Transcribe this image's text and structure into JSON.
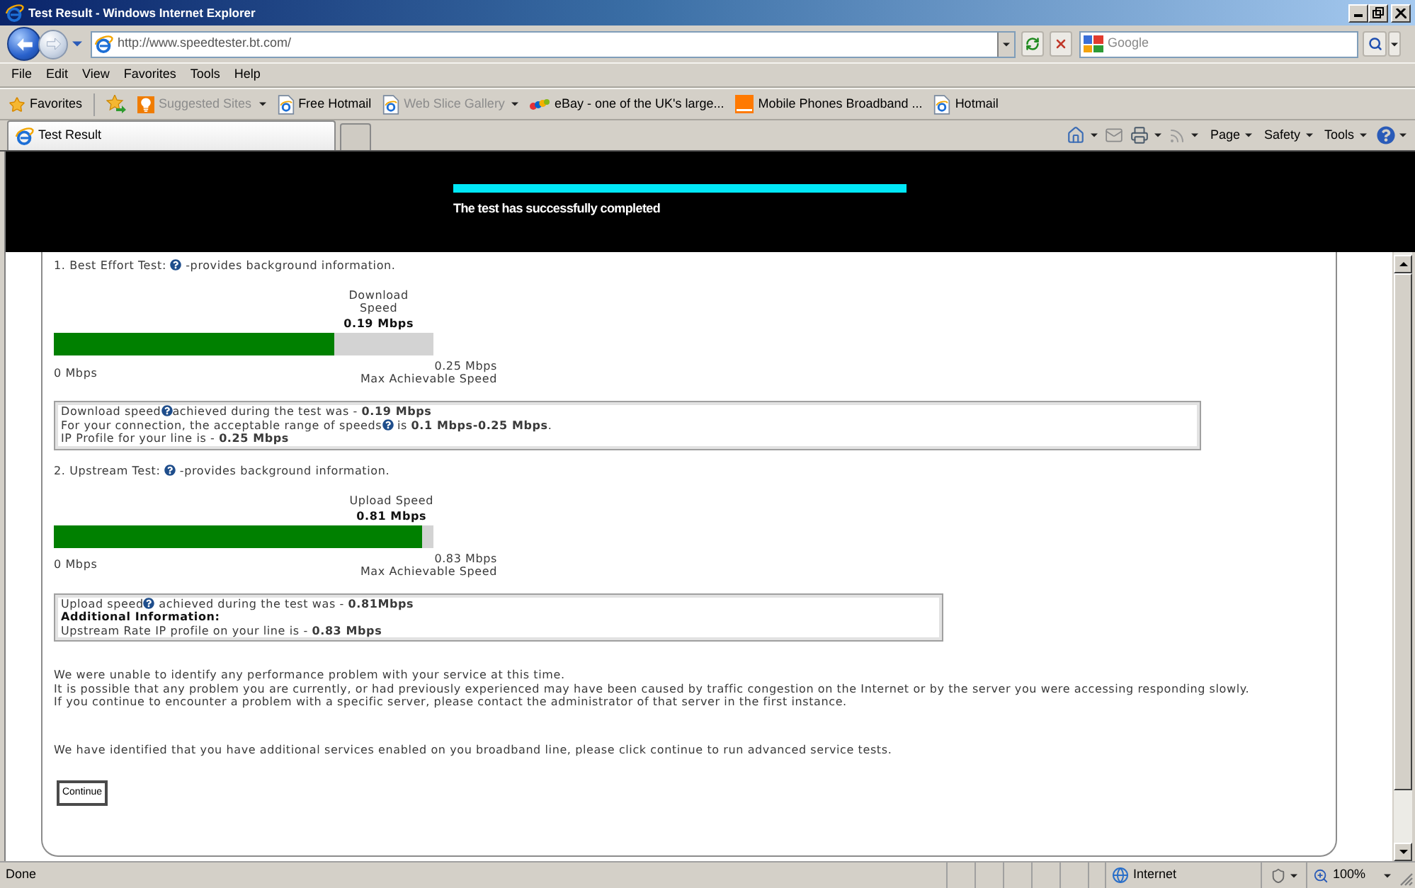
{
  "window": {
    "title": "Test Result - Windows Internet Explorer"
  },
  "address_bar": {
    "url": "http://www.speedtester.bt.com/"
  },
  "search": {
    "placeholder": "Google"
  },
  "menu": [
    "File",
    "Edit",
    "View",
    "Favorites",
    "Tools",
    "Help"
  ],
  "favorites_bar": {
    "label": "Favorites",
    "items": [
      {
        "kind": "bulb",
        "label": "Suggested Sites",
        "dropdown": true,
        "disabled": true
      },
      {
        "kind": "page",
        "label": "Free Hotmail",
        "dropdown": false,
        "disabled": false
      },
      {
        "kind": "page",
        "label": "Web Slice Gallery",
        "dropdown": true,
        "disabled": true
      },
      {
        "kind": "dots",
        "label": "eBay - one of the UK's large...",
        "dropdown": false,
        "disabled": false
      },
      {
        "kind": "square",
        "label": "Mobile Phones Broadband ...",
        "dropdown": false,
        "disabled": false
      },
      {
        "kind": "page",
        "label": "Hotmail",
        "dropdown": false,
        "disabled": false
      }
    ]
  },
  "tabs": [
    {
      "label": "Test Result",
      "selected": true
    }
  ],
  "command_bar": [
    "Page",
    "Safety",
    "Tools"
  ],
  "header": {
    "progress": {
      "level": 1
    },
    "message": "The test has successfully completed"
  },
  "tests": [
    {
      "heading": [
        {
          "kind": "text",
          "text": "1. Best Effort Test: "
        },
        {
          "kind": "help"
        },
        {
          "kind": "text",
          "text": " -provides background information."
        }
      ],
      "speed_label": "Download Speed",
      "speed": "0.19 Mbps",
      "level": 0.74,
      "min": "0 Mbps",
      "max": "0.25 Mbps",
      "max_label": "Max Achievable Speed",
      "info": [
        [
          {
            "kind": "text",
            "text": "Download speed"
          },
          {
            "kind": "help"
          },
          {
            "kind": "text",
            "text": "achieved during the test was - **0.19 Mbps**"
          }
        ],
        [
          {
            "kind": "text",
            "text": "For your connection, the acceptable range of speeds"
          },
          {
            "kind": "help"
          },
          {
            "kind": "text",
            "text": " is **0.1 Mbps-0.25 Mbps**."
          }
        ],
        [
          {
            "kind": "text",
            "text": "IP Profile for your line is - **0.25 Mbps**"
          }
        ]
      ]
    },
    {
      "heading": [
        {
          "kind": "text",
          "text": "2. Upstream Test: "
        },
        {
          "kind": "help"
        },
        {
          "kind": "text",
          "text": " -provides background information."
        }
      ],
      "speed_label": "Upload Speed",
      "speed": "0.81 Mbps",
      "level": 0.97,
      "min": "0 Mbps",
      "max": "0.83 Mbps",
      "max_label": "Max Achievable Speed",
      "info": [
        [
          {
            "kind": "text",
            "text": "Upload speed"
          },
          {
            "kind": "help"
          },
          {
            "kind": "text",
            "text": " achieved during the test was - **0.81Mbps**"
          }
        ],
        [
          {
            "kind": "strong",
            "text": "Additional Information:"
          }
        ],
        [
          {
            "kind": "text",
            "text": "Upstream Rate IP profile on your line is - **0.83 Mbps**"
          }
        ]
      ]
    }
  ],
  "notes": [
    "We were unable to identify any performance problem with your service at this time.",
    "It is possible that any problem you are currently, or had previously experienced may have been caused by traffic congestion on the Internet or by the server you were accessing responding slowly.",
    "If you continue to encounter a problem with a specific server, please contact the administrator of that server in the first instance."
  ],
  "notice": "We have identified that you have additional services enabled on you broadband line, please click continue to run advanced service tests.",
  "button": "Continue",
  "status_bar": {
    "text": "Done",
    "zone": "Internet",
    "zoom": "100%"
  }
}
